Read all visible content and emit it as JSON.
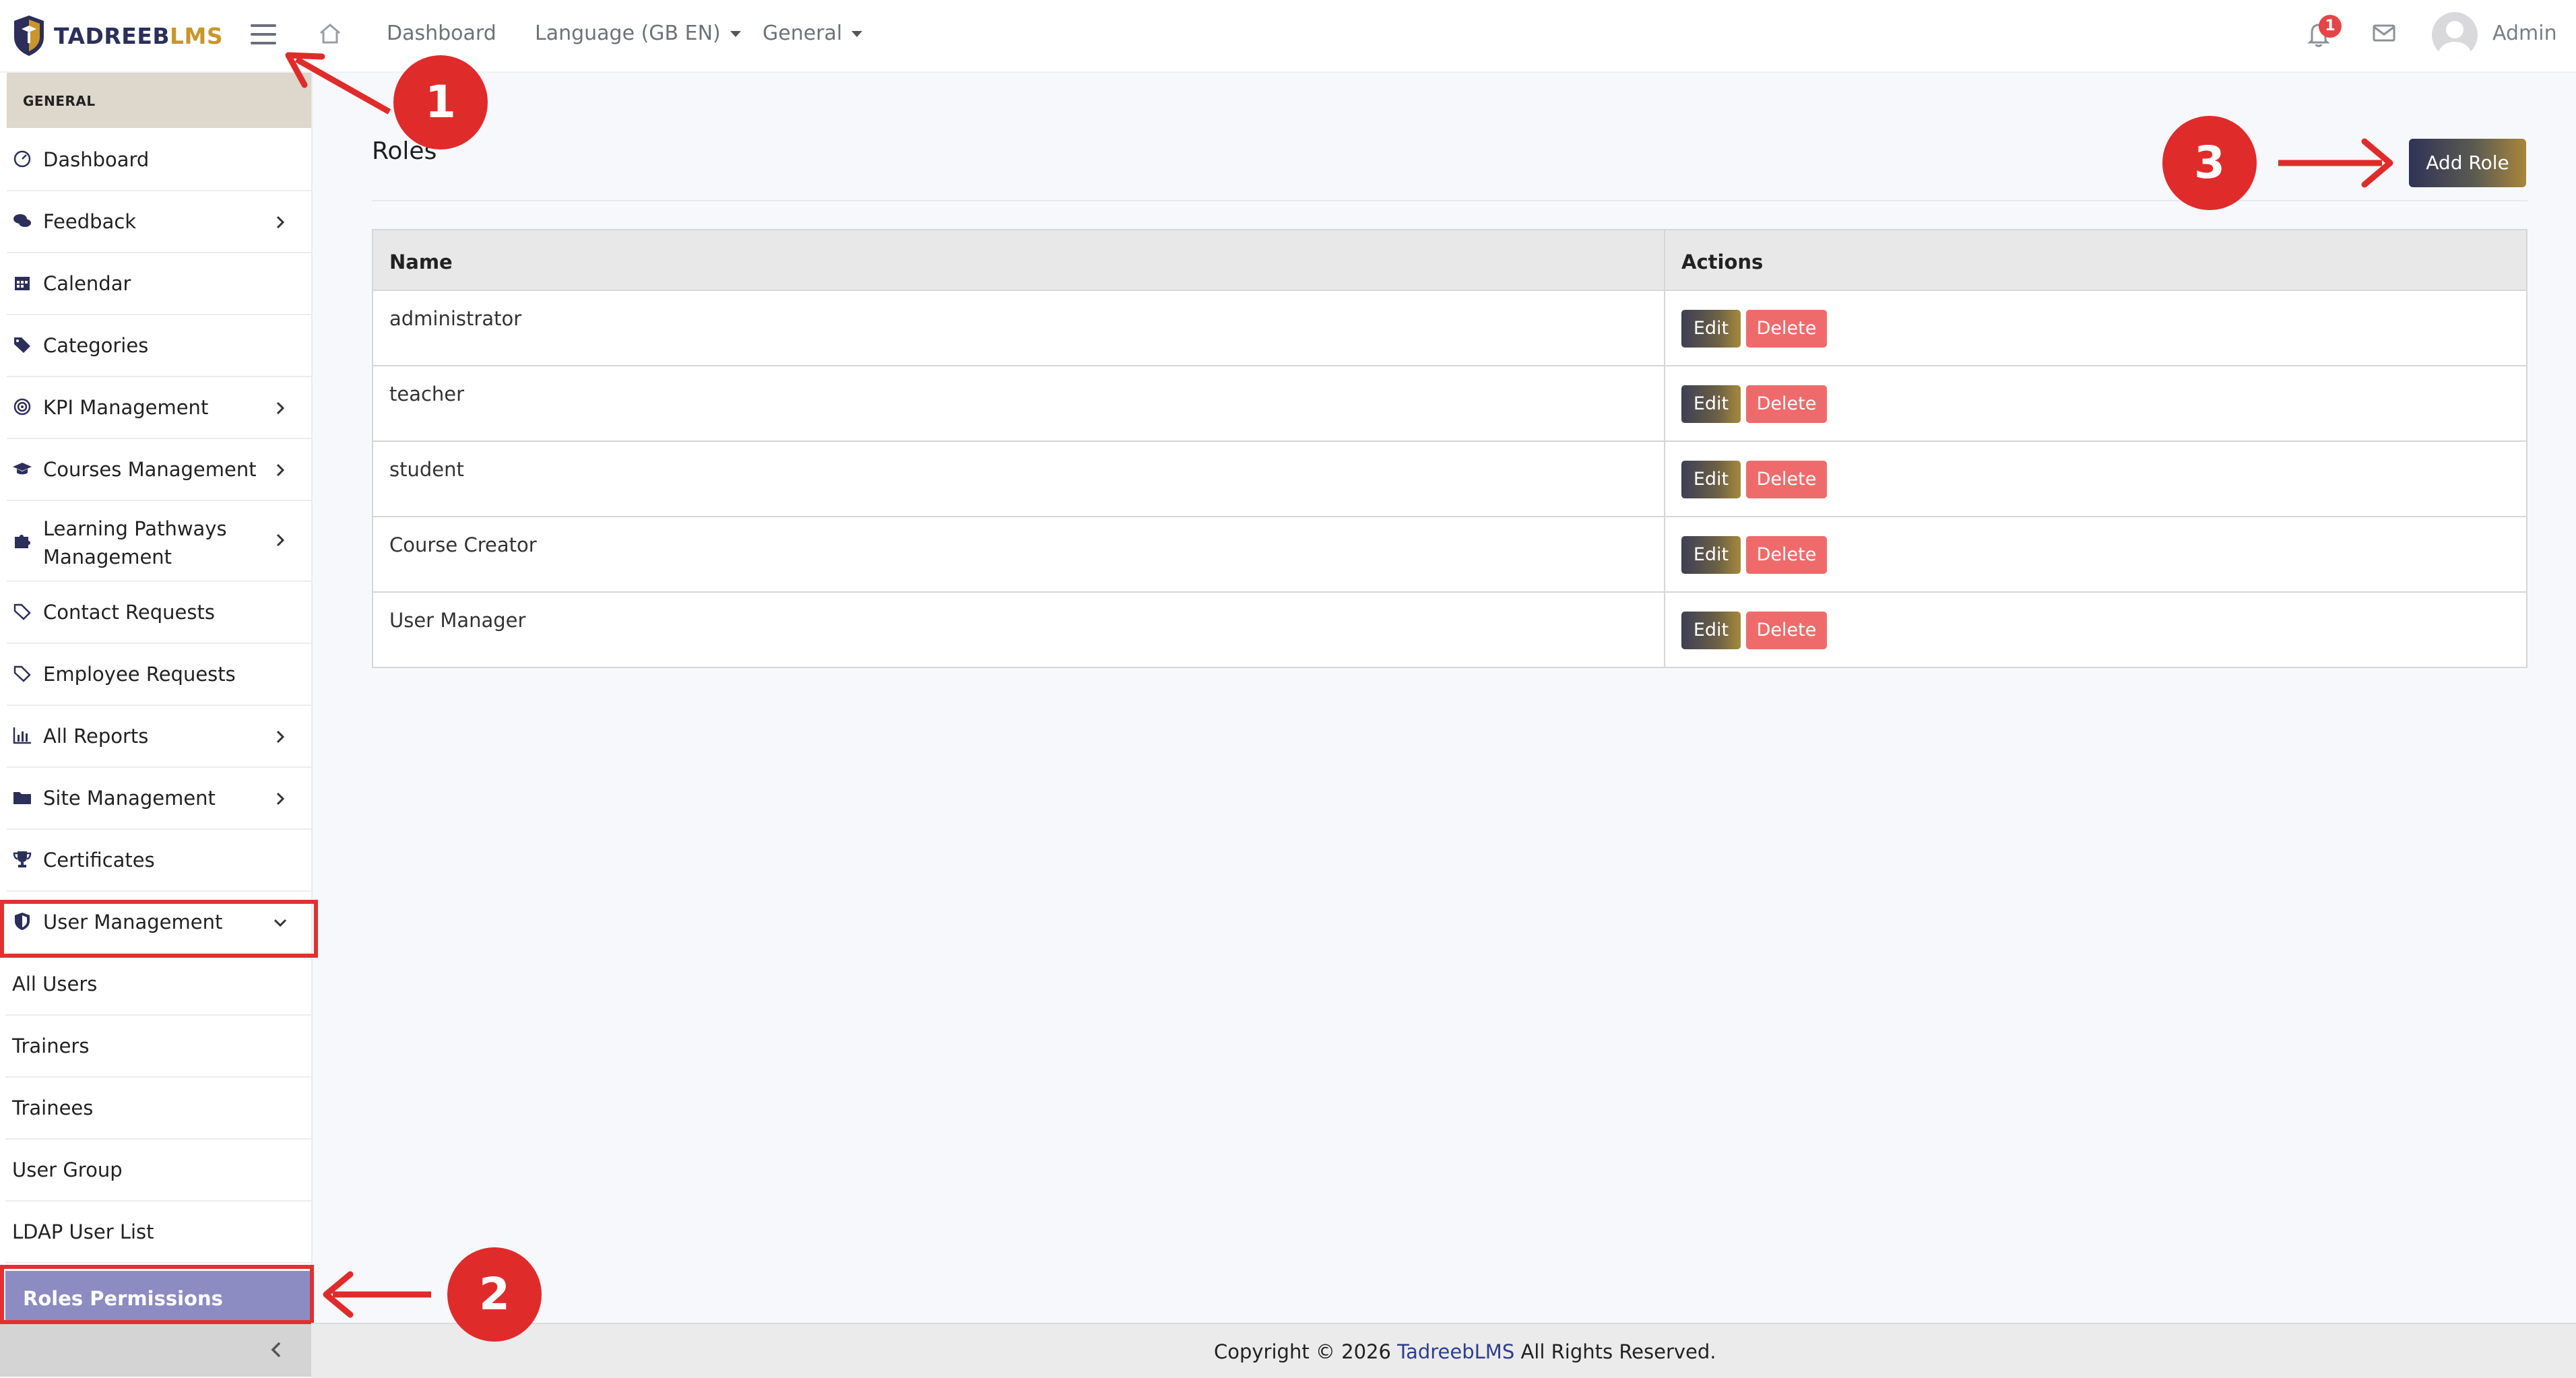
{
  "brand": {
    "name_a": "TADREEB",
    "name_b": "LMS",
    "primary": "#2b2f5a",
    "accent": "#c8962b"
  },
  "topnav": {
    "dashboard": "Dashboard",
    "language": "Language (GB EN)",
    "general": "General",
    "notification_count": "1",
    "user_name": "Admin"
  },
  "sidebar": {
    "section_label": "GENERAL",
    "items": [
      {
        "label": "Dashboard",
        "icon": "gauge-icon"
      },
      {
        "label": "Feedback",
        "icon": "comments-icon",
        "expandable": true
      },
      {
        "label": "Calendar",
        "icon": "calendar-icon"
      },
      {
        "label": "Categories",
        "icon": "tags-icon"
      },
      {
        "label": "KPI Management",
        "icon": "target-icon",
        "expandable": true
      },
      {
        "label": "Courses Management",
        "icon": "graduation-cap-icon",
        "expandable": true
      },
      {
        "label": "Learning Pathways",
        "label2": "Management",
        "icon": "puzzle-icon",
        "expandable": true
      },
      {
        "label": "Contact Requests",
        "icon": "tag-icon"
      },
      {
        "label": "Employee Requests",
        "icon": "tag-icon"
      },
      {
        "label": "All Reports",
        "icon": "bar-chart-icon",
        "expandable": true
      },
      {
        "label": "Site Management",
        "icon": "folder-icon",
        "expandable": true
      },
      {
        "label": "Certificates",
        "icon": "trophy-icon"
      },
      {
        "label": "User Management",
        "icon": "shield-icon",
        "expanded": true
      }
    ],
    "sub_items": [
      "All Users",
      "Trainers",
      "Trainees",
      "User Group",
      "LDAP User List"
    ],
    "active_item": "Roles Permissions",
    "active_color": "#8c8bc2"
  },
  "main": {
    "title": "Roles",
    "add_button": "Add Role",
    "table": {
      "headers": [
        "Name",
        "Actions"
      ],
      "rows": [
        "administrator",
        "teacher",
        "student",
        "Course Creator",
        "User Manager"
      ],
      "edit_label": "Edit",
      "delete_label": "Delete"
    }
  },
  "footer": {
    "prefix": "Copyright © 2026",
    "brand": "TadreebLMS",
    "suffix": "All Rights Reserved."
  },
  "annotations": {
    "c1": "1",
    "c2": "2",
    "c3": "3",
    "color": "#e02b2b"
  }
}
